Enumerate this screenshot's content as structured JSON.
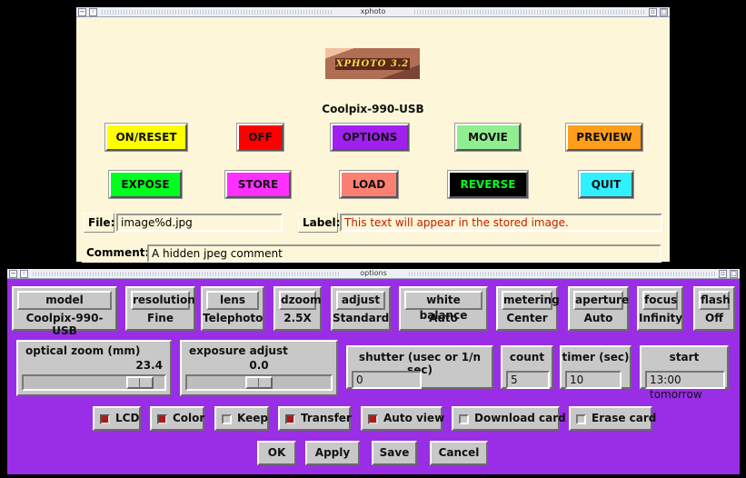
{
  "xphoto_window": {
    "title": "xphoto",
    "logo_text": "XPHOTO 3.2",
    "camera_model": "Coolpix-990-USB",
    "buttons_row1": [
      {
        "label": "ON/RESET",
        "color": "#ffff00"
      },
      {
        "label": "OFF",
        "color": "#ff0000"
      },
      {
        "label": "OPTIONS",
        "color": "#a020f0"
      },
      {
        "label": "MOVIE",
        "color": "#90ee90"
      },
      {
        "label": "PREVIEW",
        "color": "#ff9e1a"
      }
    ],
    "buttons_row2": [
      {
        "label": "EXPOSE",
        "color": "#00ff20"
      },
      {
        "label": "STORE",
        "color": "#ff30ff"
      },
      {
        "label": "LOAD",
        "color": "#fa8072"
      },
      {
        "label": "REVERSE",
        "color": "#000000",
        "text_color": "#00ff20"
      },
      {
        "label": "QUIT",
        "color": "#30f0ff"
      }
    ],
    "file_label": "File:",
    "file_value": "image%d.jpg",
    "label_label": "Label:",
    "label_value": "This text will appear in the stored image.",
    "label_value_color": "#c02000",
    "comment_label": "Comment:",
    "comment_value": "A hidden jpeg comment"
  },
  "options_window": {
    "title": "options",
    "settings": [
      {
        "name": "model",
        "value": "Coolpix-990-USB"
      },
      {
        "name": "resolution",
        "value": "Fine"
      },
      {
        "name": "lens",
        "value": "Telephoto"
      },
      {
        "name": "dzoom",
        "value": "2.5X"
      },
      {
        "name": "adjust",
        "value": "Standard"
      },
      {
        "name": "white balance",
        "value": "Auto"
      },
      {
        "name": "metering",
        "value": "Center"
      },
      {
        "name": "aperture",
        "value": "Auto"
      },
      {
        "name": "focus",
        "value": "Infinity"
      },
      {
        "name": "flash",
        "value": "Off"
      }
    ],
    "optical_zoom": {
      "label": "optical zoom (mm)",
      "value": "23.4",
      "position": 0.9
    },
    "exposure_adjust": {
      "label": "exposure adjust",
      "value": "0.0",
      "position": 0.5
    },
    "shutter": {
      "label": "shutter (usec or 1/n sec)",
      "value": "0"
    },
    "count": {
      "label": "count",
      "value": "5"
    },
    "timer": {
      "label": "timer (sec)",
      "value": "10"
    },
    "start": {
      "label": "start",
      "value": "13:00 tomorrow"
    },
    "checkboxes": [
      {
        "label": "LCD",
        "checked": true
      },
      {
        "label": "Color",
        "checked": true
      },
      {
        "label": "Keep",
        "checked": false
      },
      {
        "label": "Transfer",
        "checked": true
      },
      {
        "label": "Auto view",
        "checked": true
      },
      {
        "label": "Download card",
        "checked": false
      },
      {
        "label": "Erase card",
        "checked": false
      }
    ],
    "actions": {
      "ok": "OK",
      "apply": "Apply",
      "save": "Save",
      "cancel": "Cancel"
    },
    "background_color": "#9a2ee6"
  }
}
